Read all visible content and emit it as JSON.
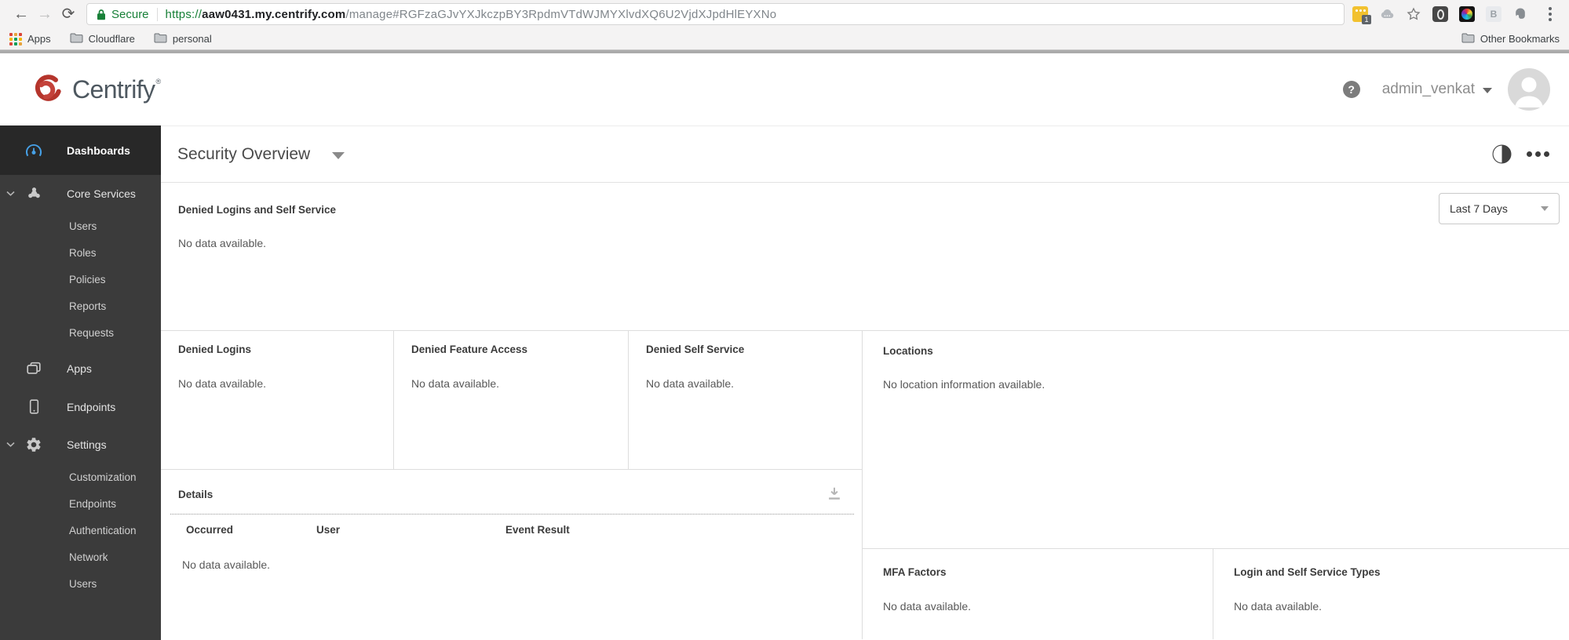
{
  "icons": {
    "back": "←",
    "forward": "→",
    "reload": "⟳",
    "help": "?"
  },
  "browser": {
    "security_label": "Secure",
    "url": {
      "scheme": "https://",
      "domain": "aaw0431.my.centrify.com",
      "path": "/manage#RGFzaGJvYXJkczpBY3RpdmVTdWJMYXlvdXQ6U2VjdXJpdHlEYXNo"
    },
    "extensions": {
      "badge": "1",
      "b_label": "B"
    },
    "bookmarks_bar": {
      "apps": "Apps",
      "folders": [
        "Cloudflare",
        "personal"
      ],
      "other": "Other Bookmarks"
    }
  },
  "header": {
    "brand": "Centrify",
    "brand_mark": "®",
    "username": "admin_venkat"
  },
  "sidebar": {
    "items": [
      {
        "label": "Dashboards"
      },
      {
        "label": "Core Services",
        "children": [
          "Users",
          "Roles",
          "Policies",
          "Reports",
          "Requests"
        ]
      },
      {
        "label": "Apps"
      },
      {
        "label": "Endpoints"
      },
      {
        "label": "Settings",
        "children": [
          "Customization",
          "Endpoints",
          "Authentication",
          "Network",
          "Users"
        ]
      }
    ]
  },
  "main": {
    "title": "Security Overview",
    "actions": {
      "time_filter": "Last 7 Days"
    },
    "panels": {
      "denied_logins_and_self_service": {
        "title": "Denied Logins and Self Service",
        "empty": "No data available."
      },
      "denied_logins": {
        "title": "Denied Logins",
        "empty": "No data available."
      },
      "denied_feature_access": {
        "title": "Denied Feature Access",
        "empty": "No data available."
      },
      "denied_self_service": {
        "title": "Denied Self Service",
        "empty": "No data available."
      },
      "locations": {
        "title": "Locations",
        "empty": "No location information available."
      },
      "details": {
        "title": "Details",
        "columns": [
          "Occurred",
          "User",
          "Event Result"
        ],
        "empty": "No data available."
      },
      "mfa_factors": {
        "title": "MFA Factors",
        "empty": "No data available."
      },
      "login_and_self_service_types": {
        "title": "Login and Self Service Types",
        "empty": "No data available."
      }
    }
  }
}
